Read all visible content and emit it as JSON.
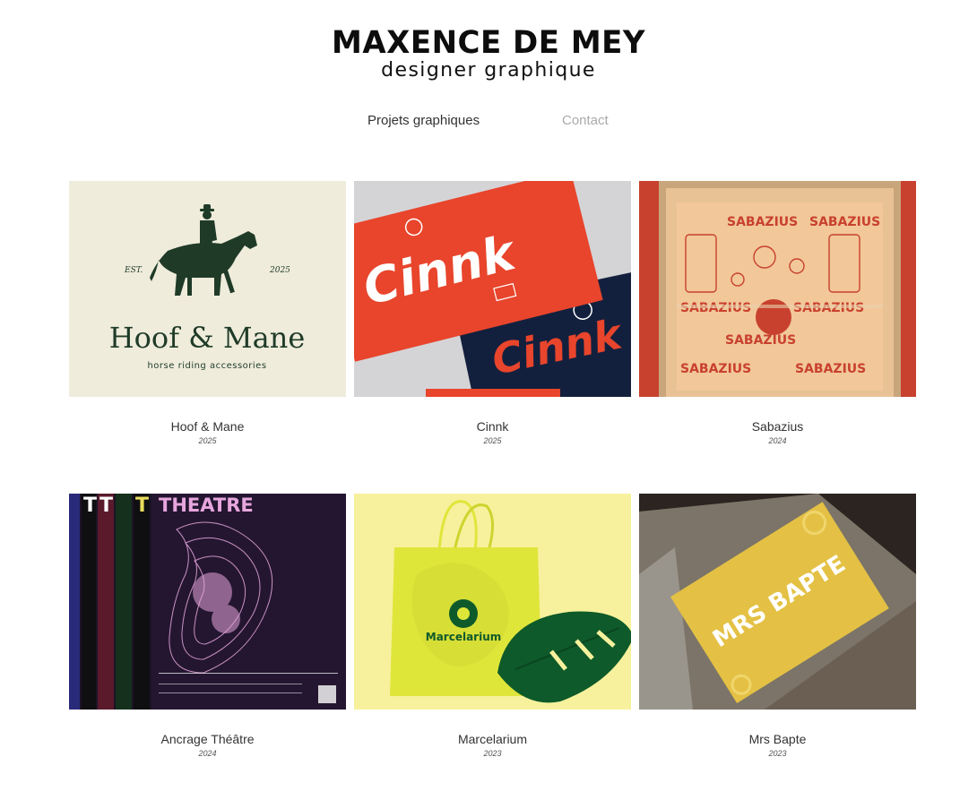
{
  "header": {
    "name": "MAXENCE DE MEY",
    "subtitle": "designer graphique"
  },
  "nav": {
    "items": [
      {
        "label": "Projets graphiques"
      },
      {
        "label": "Contact"
      }
    ]
  },
  "projects": [
    {
      "title": "Hoof & Mane",
      "year": "2025",
      "art": {
        "est": "EST.",
        "year_mark": "2025",
        "wordmark": "Hoof & Mane",
        "tagline": "horse riding accessories"
      }
    },
    {
      "title": "Cinnk",
      "year": "2025",
      "art": {
        "wordmark": "Cinnk"
      }
    },
    {
      "title": "Sabazius",
      "year": "2024",
      "art": {
        "wordmark": "SABAZIUS"
      }
    },
    {
      "title": "Ancrage Théâtre",
      "year": "2024",
      "art": {
        "heading": "THEATRE"
      }
    },
    {
      "title": "Marcelarium",
      "year": "2023",
      "art": {
        "wordmark": "Marcelarium"
      }
    },
    {
      "title": "Mrs Bapte",
      "year": "2023",
      "art": {
        "wordmark": "MRS BAPTE"
      }
    }
  ],
  "colors": {
    "hoof_bg": "#efecdc",
    "hoof_ink": "#1f3b28",
    "cinnk_red": "#e8452c",
    "cinnk_navy": "#13203d",
    "sabazius_red": "#c8412e",
    "sabazius_paper": "#f2c79a",
    "theatre_bg": "#1d1326",
    "theatre_pink": "#e7a6dd",
    "marcel_yellow": "#f7f19d",
    "marcel_bag": "#dfe63a",
    "marcel_green": "#0e5a2a",
    "bapte_card": "#e4c144",
    "bapte_stone": "#9a958c"
  }
}
